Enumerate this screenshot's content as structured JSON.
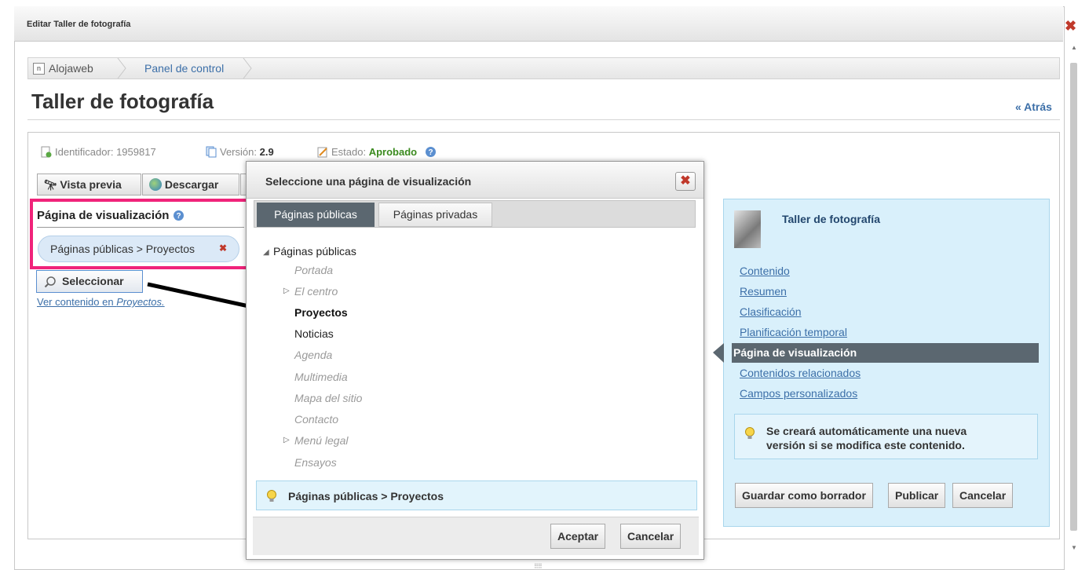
{
  "window": {
    "title": "Editar Taller de fotografía",
    "close": "✖"
  },
  "breadcrumb": {
    "items": [
      "Alojaweb",
      "Panel de control"
    ]
  },
  "page": {
    "title": "Taller de fotografía",
    "back_link": "« Atrás"
  },
  "meta": {
    "id_label": "Identificador:",
    "id_value": "1959817",
    "version_label": "Versión:",
    "version_value": "2.9",
    "status_label": "Estado:",
    "status_value": "Aprobado"
  },
  "toolbar": {
    "preview": "Vista previa",
    "download": "Descargar"
  },
  "display_page": {
    "label": "Página de visualización",
    "selected_path": "Páginas públicas > Proyectos",
    "remove": "✖",
    "select_button": "Seleccionar",
    "view_link_prefix": "Ver contenido en ",
    "view_link_target": "Proyectos."
  },
  "right_panel": {
    "title": "Taller de fotografía",
    "links": [
      "Contenido",
      "Resumen",
      "Clasificación",
      "Planificación temporal"
    ],
    "active": "Página de visualización",
    "links_after": [
      "Contenidos relacionados",
      "Campos personalizados"
    ],
    "note": "Se creará automáticamente una nueva versión si se modifica este contenido.",
    "buttons": {
      "draft": "Guardar como borrador",
      "publish": "Publicar",
      "cancel": "Cancelar"
    }
  },
  "modal": {
    "title": "Seleccione una página de visualización",
    "close": "✖",
    "tabs": [
      "Páginas públicas",
      "Páginas privadas"
    ],
    "tree_root": "Páginas públicas",
    "tree": [
      {
        "label": "Portada",
        "state": "disabled"
      },
      {
        "label": "El centro",
        "state": "disabled",
        "expandable": true
      },
      {
        "label": "Proyectos",
        "state": "selected"
      },
      {
        "label": "Noticias",
        "state": "enabled"
      },
      {
        "label": "Agenda",
        "state": "disabled"
      },
      {
        "label": "Multimedia",
        "state": "disabled"
      },
      {
        "label": "Mapa del sitio",
        "state": "disabled"
      },
      {
        "label": "Contacto",
        "state": "disabled"
      },
      {
        "label": "Menú legal",
        "state": "disabled",
        "expandable": true
      },
      {
        "label": "Ensayos",
        "state": "disabled"
      }
    ],
    "selection": "Páginas públicas > Proyectos",
    "ok": "Aceptar",
    "cancel": "Cancelar"
  },
  "colors": {
    "accent": "#3c6fa8",
    "highlight": "#f0237a",
    "status_ok": "#3a8a1e",
    "active_bg": "#5b6770",
    "panel_bg": "#d9f0fb"
  }
}
